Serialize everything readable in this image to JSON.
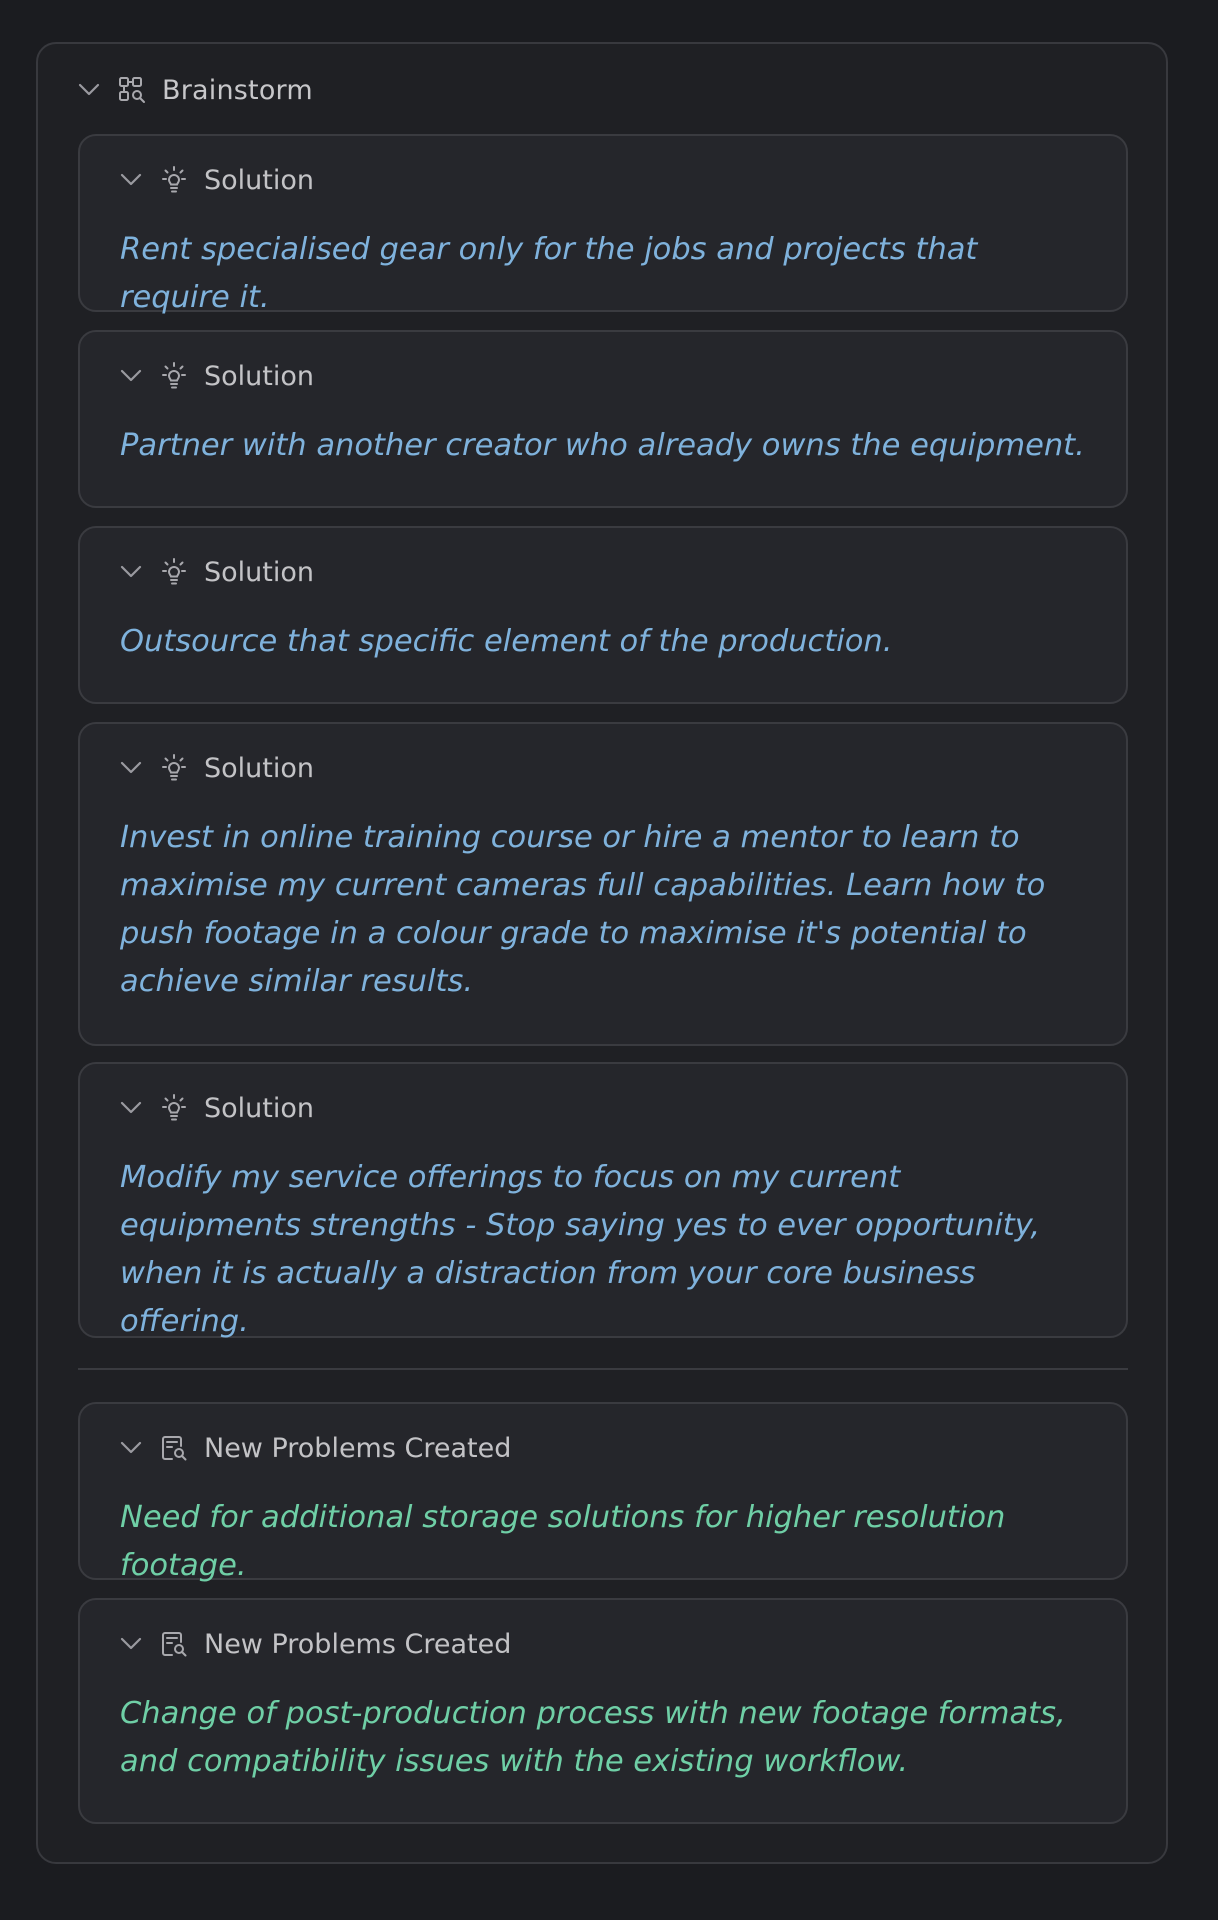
{
  "brainstorm": {
    "title": "Brainstorm",
    "icon": "mind-map-icon"
  },
  "solutions": [
    {
      "label": "Solution",
      "icon": "lightbulb-icon",
      "text": "Rent specialised gear only for the jobs and projects that require it."
    },
    {
      "label": "Solution",
      "icon": "lightbulb-icon",
      "text": "Partner with another creator who already owns the equipment."
    },
    {
      "label": "Solution",
      "icon": "lightbulb-icon",
      "text": "Outsource that specific element of the production."
    },
    {
      "label": "Solution",
      "icon": "lightbulb-icon",
      "text": "Invest in online training course or hire a mentor to learn to maximise my current cameras full capabilities. Learn how to push footage in a colour grade to maximise it's potential to achieve similar results."
    },
    {
      "label": "Solution",
      "icon": "lightbulb-icon",
      "text": "Modify my service offerings to focus on my current equipments strengths - Stop saying yes to ever opportunity, when it is actually a distraction from your core business offering."
    }
  ],
  "new_problems": [
    {
      "label": "New Problems Created",
      "icon": "document-search-icon",
      "text": "Need for additional storage solutions for higher resolution footage."
    },
    {
      "label": "New Problems Created",
      "icon": "document-search-icon",
      "text": "Change of post-production process with new footage formats, and compatibility issues with the existing workflow."
    }
  ],
  "colors": {
    "solution_text": "#7fb2dc",
    "problem_text": "#6fcfa6",
    "background": "#1b1c20",
    "card_background": "#25262b"
  }
}
